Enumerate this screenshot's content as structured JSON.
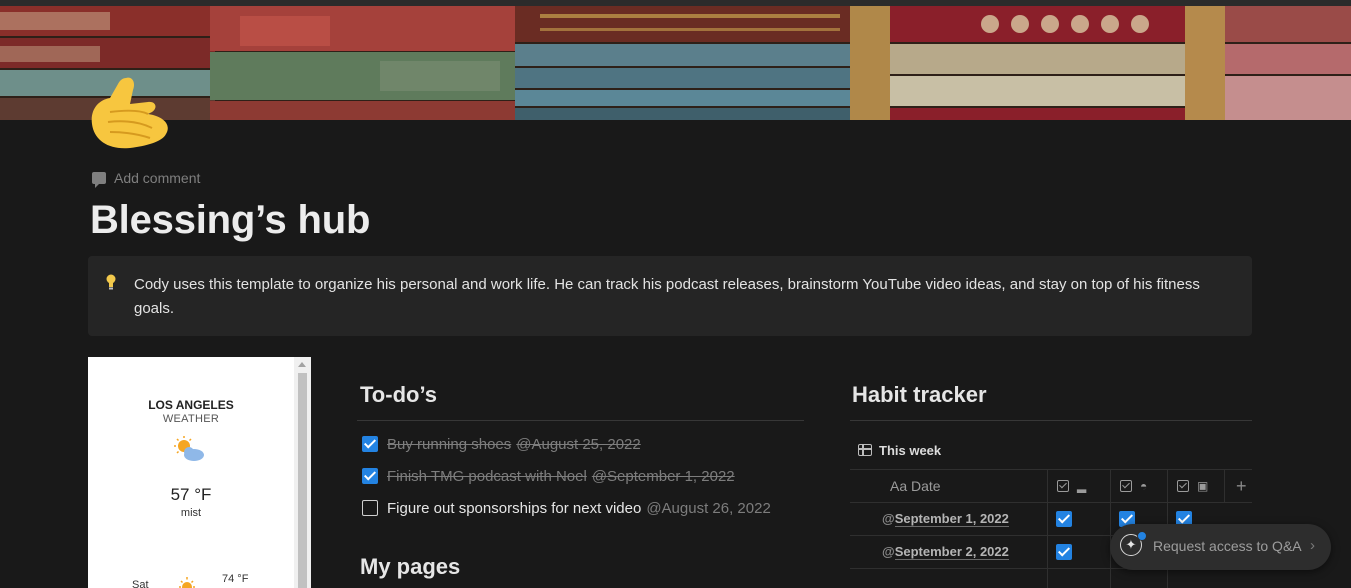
{
  "page": {
    "add_comment": "Add comment",
    "title": "Blessing’s hub",
    "callout": "Cody uses this template to organize his personal and work life. He can track his podcast releases, brainstorm YouTube video ideas, and stay on top of his fitness goals.",
    "icon_name": "call-me-hand-emoji",
    "accent_color": "#2383e2",
    "background_color": "#191919"
  },
  "weather": {
    "city": "LOS ANGELES",
    "label": "WEATHER",
    "temp": "57 °F",
    "condition": "mist",
    "icon": "sun-behind-cloud-icon",
    "forecast": [
      {
        "day": "Sat",
        "icon": "sun-icon",
        "temp": "74 °F"
      }
    ]
  },
  "todos": {
    "heading": "To-do’s",
    "items": [
      {
        "text": "Buy running shoes",
        "date": "@August 25, 2022",
        "checked": true
      },
      {
        "text": "Finish TMG podcast with Noel",
        "date": "@September 1, 2022",
        "checked": true
      },
      {
        "text": "Figure out sponsorships for next video",
        "date": "@August 26, 2022",
        "checked": false
      }
    ]
  },
  "pages": {
    "heading": "My pages"
  },
  "habits": {
    "heading": "Habit tracker",
    "view_name": "This week",
    "columns": {
      "date": "Aa Date",
      "habit_icons": [
        "running-shoe-icon",
        "wave-icon",
        "camera-icon"
      ]
    },
    "rows": [
      {
        "date": "September 1, 2022",
        "checks": [
          true,
          true,
          true
        ]
      },
      {
        "date": "September 2, 2022",
        "checks": [
          true,
          false,
          false
        ]
      }
    ]
  },
  "request": {
    "label": "Request access to Q&A",
    "chevron": "›"
  }
}
